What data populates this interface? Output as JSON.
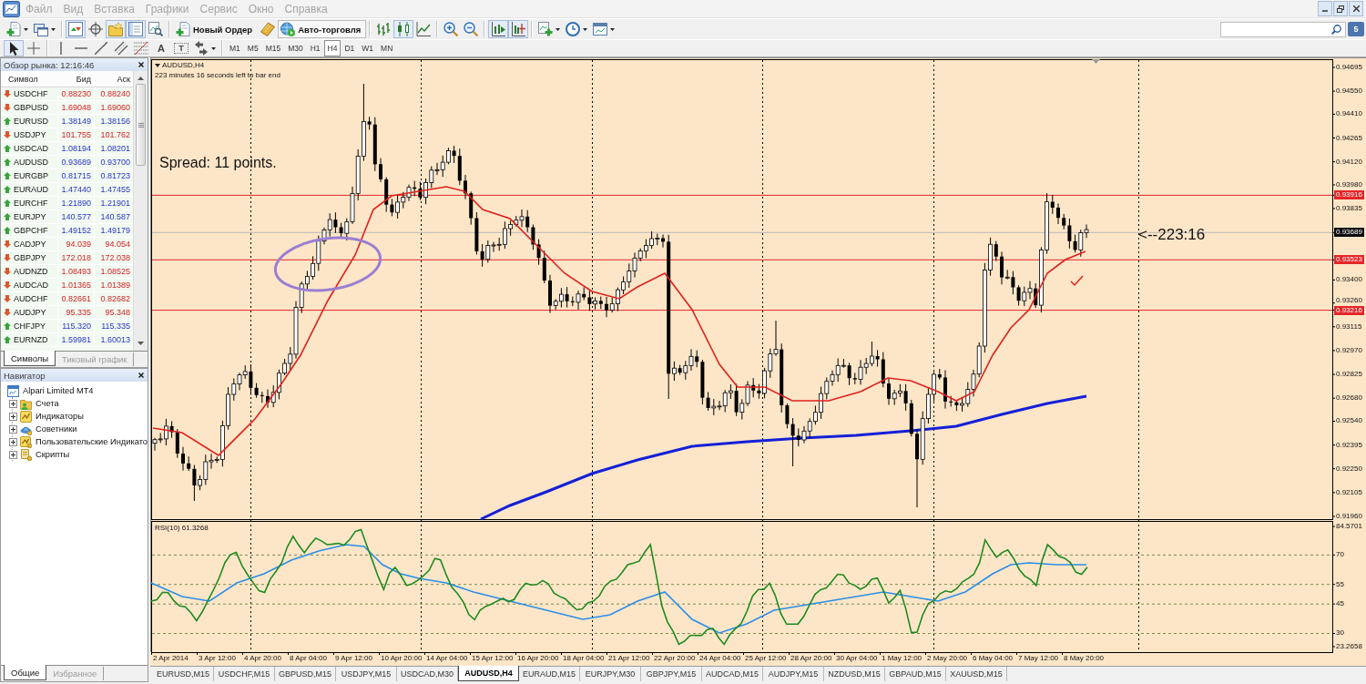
{
  "menu": [
    "Файл",
    "Вид",
    "Вставка",
    "Графики",
    "Сервис",
    "Окно",
    "Справка"
  ],
  "toolbar": [
    [
      {
        "kind": "icon",
        "on": false
      },
      {
        "kind": "icon",
        "on": false
      }
    ],
    [
      {
        "kind": "icon",
        "on": true
      },
      {
        "kind": "icon",
        "on": false
      },
      {
        "kind": "icon",
        "on": true
      },
      {
        "kind": "icon",
        "on": true
      },
      {
        "kind": "icon",
        "on": false
      }
    ],
    [
      {
        "kind": "button",
        "label": "Новый Ордер"
      },
      {
        "kind": "icon",
        "on": false
      },
      {
        "kind": "button",
        "label": "Авто-торговля"
      }
    ],
    [
      {
        "kind": "icon",
        "on": false
      },
      {
        "kind": "icon",
        "on": true
      },
      {
        "kind": "icon",
        "on": false
      }
    ],
    [
      {
        "kind": "icon",
        "on": false
      },
      {
        "kind": "icon",
        "on": false
      }
    ],
    [
      {
        "kind": "icon",
        "on": true
      },
      {
        "kind": "icon",
        "on": true
      }
    ],
    [
      {
        "kind": "icon",
        "on": false
      },
      {
        "kind": "icon",
        "on": false
      },
      {
        "kind": "icon",
        "on": false
      }
    ]
  ],
  "messages": "5",
  "drawing_tools": [
    [
      {
        "kind": "icon",
        "on": true
      },
      {
        "kind": "icon",
        "on": false
      }
    ],
    [
      {
        "kind": "icon",
        "on": false
      },
      {
        "kind": "icon",
        "on": false
      },
      {
        "kind": "icon",
        "on": false
      },
      {
        "kind": "icon",
        "on": false
      },
      {
        "kind": "icon",
        "on": false
      },
      {
        "kind": "glyph",
        "label": "A",
        "on": false
      },
      {
        "kind": "glyph",
        "label": "T",
        "on": false
      },
      {
        "kind": "icon",
        "on": false
      }
    ]
  ],
  "periods": [
    {
      "label": "M1",
      "selected": false
    },
    {
      "label": "M5",
      "selected": false
    },
    {
      "label": "M15",
      "selected": false
    },
    {
      "label": "M30",
      "selected": false
    },
    {
      "label": "H1",
      "selected": false
    },
    {
      "label": "H4",
      "selected": true
    },
    {
      "label": "D1",
      "selected": false
    },
    {
      "label": "W1",
      "selected": false
    },
    {
      "label": "MN",
      "selected": false
    }
  ],
  "market_watch": {
    "title": "Обзор рынка: 12:16:46",
    "columns": [
      "Символ",
      "Бид",
      "Аск"
    ],
    "rows": [
      {
        "symbol": "USDCHF",
        "bid": "0.88230",
        "ask": "0.88240",
        "rising": false
      },
      {
        "symbol": "GBPUSD",
        "bid": "1.69048",
        "ask": "1.69060",
        "rising": false
      },
      {
        "symbol": "EURUSD",
        "bid": "1.38149",
        "ask": "1.38156",
        "rising": true
      },
      {
        "symbol": "USDJPY",
        "bid": "101.755",
        "ask": "101.762",
        "rising": false
      },
      {
        "symbol": "USDCAD",
        "bid": "1.08194",
        "ask": "1.08201",
        "rising": true
      },
      {
        "symbol": "AUDUSD",
        "bid": "0.93689",
        "ask": "0.93700",
        "rising": true
      },
      {
        "symbol": "EURGBP",
        "bid": "0.81715",
        "ask": "0.81723",
        "rising": true
      },
      {
        "symbol": "EURAUD",
        "bid": "1.47440",
        "ask": "1.47455",
        "rising": true
      },
      {
        "symbol": "EURCHF",
        "bid": "1.21890",
        "ask": "1.21901",
        "rising": true
      },
      {
        "symbol": "EURJPY",
        "bid": "140.577",
        "ask": "140.587",
        "rising": true
      },
      {
        "symbol": "GBPCHF",
        "bid": "1.49152",
        "ask": "1.49179",
        "rising": true
      },
      {
        "symbol": "CADJPY",
        "bid": "94.039",
        "ask": "94.054",
        "rising": false
      },
      {
        "symbol": "GBPJPY",
        "bid": "172.018",
        "ask": "172.038",
        "rising": false
      },
      {
        "symbol": "AUDNZD",
        "bid": "1.08493",
        "ask": "1.08525",
        "rising": false
      },
      {
        "symbol": "AUDCAD",
        "bid": "1.01365",
        "ask": "1.01389",
        "rising": false
      },
      {
        "symbol": "AUDCHF",
        "bid": "0.82661",
        "ask": "0.82682",
        "rising": false
      },
      {
        "symbol": "AUDJPY",
        "bid": "95.335",
        "ask": "95.348",
        "rising": false
      },
      {
        "symbol": "CHFJPY",
        "bid": "115.320",
        "ask": "115.335",
        "rising": true
      },
      {
        "symbol": "EURNZD",
        "bid": "1.59981",
        "ask": "1.60013",
        "rising": true
      }
    ],
    "tabs": [
      {
        "label": "Символы",
        "selected": true
      },
      {
        "label": "Тиковый график",
        "selected": false
      }
    ]
  },
  "navigator": {
    "title": "Навигатор",
    "tree": [
      {
        "label": "Alpari Limited MT4",
        "kind": "root",
        "children": [
          {
            "label": "Счета",
            "kind": "accounts",
            "expanded": false
          },
          {
            "label": "Индикаторы",
            "kind": "indicators",
            "expanded": false
          },
          {
            "label": "Советники",
            "kind": "experts",
            "expanded": false
          },
          {
            "label": "Пользовательские Индикато",
            "kind": "custom",
            "expanded": false
          },
          {
            "label": "Скрипты",
            "kind": "scripts",
            "expanded": false
          }
        ]
      }
    ],
    "tabs": [
      {
        "label": "Общие",
        "selected": true
      },
      {
        "label": "Избранное",
        "selected": false
      }
    ]
  },
  "chart": {
    "title": "AUDUSD,H4",
    "bar_timer": "223 minutes 16 seconds left to bar end",
    "spread_note": "Spread: 11 points.",
    "timer_note": "<--223:16",
    "price_axis": [
      {
        "label": "0.94695",
        "kind": "tick"
      },
      {
        "label": "0.94550",
        "kind": "tick"
      },
      {
        "label": "0.94410",
        "kind": "tick"
      },
      {
        "label": "0.94265",
        "kind": "tick"
      },
      {
        "label": "0.94120",
        "kind": "tick"
      },
      {
        "label": "0.93980",
        "kind": "tick"
      },
      {
        "label": "0.93916",
        "kind": "level"
      },
      {
        "label": "0.93835",
        "kind": "tick"
      },
      {
        "label": "0.93689",
        "kind": "bid"
      },
      {
        "label": "0.93523",
        "kind": "level"
      },
      {
        "label": "0.93400",
        "kind": "tick"
      },
      {
        "label": "0.93260",
        "kind": "tick"
      },
      {
        "label": "0.93216",
        "kind": "level"
      },
      {
        "label": "0.93115",
        "kind": "tick"
      },
      {
        "label": "0.92970",
        "kind": "tick"
      },
      {
        "label": "0.92825",
        "kind": "tick"
      },
      {
        "label": "0.92680",
        "kind": "tick"
      },
      {
        "label": "0.92540",
        "kind": "tick"
      },
      {
        "label": "0.92395",
        "kind": "tick"
      },
      {
        "label": "0.92250",
        "kind": "tick"
      },
      {
        "label": "0.92105",
        "kind": "tick"
      },
      {
        "label": "0.91960",
        "kind": "tick"
      }
    ],
    "indicator": {
      "label": "RSI(10) 61.3268",
      "axis": [
        {
          "label": "84.5701",
          "kind": "bound"
        },
        {
          "label": "70",
          "kind": "level"
        },
        {
          "label": "55",
          "kind": "level"
        },
        {
          "label": "45",
          "kind": "level"
        },
        {
          "label": "30",
          "kind": "level"
        },
        {
          "label": "23.2658",
          "kind": "bound"
        }
      ]
    },
    "time_axis": [
      "2 Apr 2014",
      "3 Apr 12:00",
      "4 Apr 20:00",
      "8 Apr 04:00",
      "9 Apr 12:00",
      "10 Apr 20:00",
      "14 Apr 04:00",
      "15 Apr 12:00",
      "16 Apr 20:00",
      "18 Apr 04:00",
      "21 Apr 12:00",
      "22 Apr 20:00",
      "24 Apr 04:00",
      "25 Apr 12:00",
      "28 Apr 20:00",
      "30 Apr 04:00",
      "1 May 12:00",
      "2 May 20:00",
      "6 May 04:00",
      "7 May 12:00",
      "8 May 20:00"
    ]
  },
  "chart_tabs": [
    {
      "label": "EURUSD,M15",
      "selected": false
    },
    {
      "label": "USDCHF,M15",
      "selected": false
    },
    {
      "label": "GBPUSD,M15",
      "selected": false
    },
    {
      "label": "USDJPY,M15",
      "selected": false
    },
    {
      "label": "USDCAD,M30",
      "selected": false
    },
    {
      "label": "AUDUSD,H4",
      "selected": true
    },
    {
      "label": "EURAUD,M15",
      "selected": false
    },
    {
      "label": "EURJPY,M30",
      "selected": false
    },
    {
      "label": "GBPJPY,M15",
      "selected": false
    },
    {
      "label": "AUDCAD,M15",
      "selected": false
    },
    {
      "label": "AUDJPY,M15",
      "selected": false
    },
    {
      "label": "NZDUSD,M15",
      "selected": false
    },
    {
      "label": "GBPAUD,M15",
      "selected": false
    },
    {
      "label": "XAUUSD,M15",
      "selected": false
    }
  ]
}
